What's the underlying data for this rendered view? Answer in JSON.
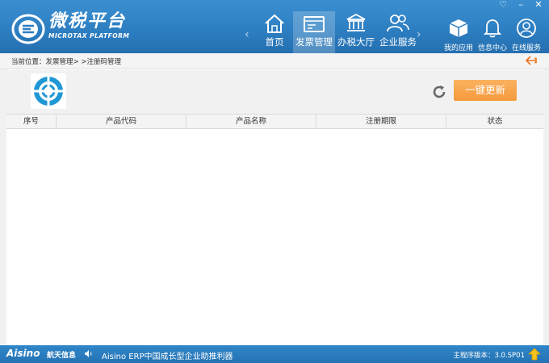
{
  "app": {
    "brand_cn": "微税平台",
    "brand_en": "MICROTAX PLATFORM",
    "window_controls": [
      "♡",
      "–",
      "✕"
    ]
  },
  "nav": {
    "tabs": [
      {
        "label": "首页",
        "icon": "home-icon"
      },
      {
        "label": "发票管理",
        "icon": "invoice-icon"
      },
      {
        "label": "办税大厅",
        "icon": "bank-icon"
      },
      {
        "label": "企业服务",
        "icon": "users-icon"
      }
    ],
    "active": "发票管理"
  },
  "tools": [
    {
      "label": "我的应用",
      "icon": "box-icon"
    },
    {
      "label": "信息中心",
      "icon": "bell-icon"
    },
    {
      "label": "在线服务",
      "icon": "support-icon"
    }
  ],
  "breadcrumb": "当前位置：发票管理> >注册码管理",
  "toolbar": {
    "update_label": "一键更新"
  },
  "table": {
    "columns": [
      "序号",
      "产品代码",
      "产品名称",
      "注册期限",
      "状态"
    ],
    "rows": []
  },
  "footer": {
    "logo": "Aisino",
    "logo_cn": "航天信息",
    "marquee": "Aisino ERP中国成长型企业助推利器",
    "version": "主程序版本：3.0.SP01"
  },
  "colors": {
    "header": "#2d7fc2",
    "accent_button": "#f7a244",
    "back_arrow": "#e8731f"
  }
}
